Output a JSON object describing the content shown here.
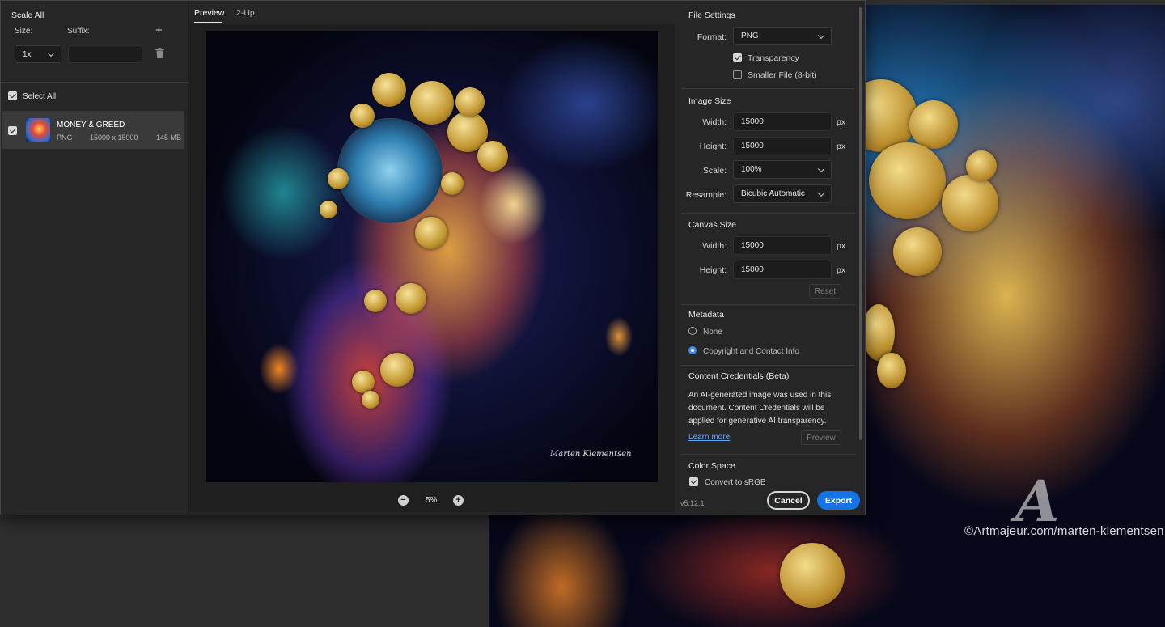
{
  "left_panel": {
    "scale_all_title": "Scale All",
    "size_label": "Size:",
    "suffix_label": "Suffix:",
    "size_value": "1x",
    "suffix_value": "",
    "select_all_label": "Select All",
    "asset": {
      "name": "MONEY & GREED",
      "format": "PNG",
      "dimensions": "15000 x 15000",
      "file_size": "145 MB"
    }
  },
  "preview": {
    "tabs": [
      "Preview",
      "2-Up"
    ],
    "zoom_level": "5%",
    "signature": "Marten Klementsen"
  },
  "file_settings": {
    "title": "File Settings",
    "format_label": "Format:",
    "format_value": "PNG",
    "transparency_label": "Transparency",
    "transparency_checked": true,
    "smaller_file_label": "Smaller File (8-bit)",
    "smaller_file_checked": false
  },
  "image_size": {
    "title": "Image Size",
    "width_label": "Width:",
    "width_value": "15000",
    "height_label": "Height:",
    "height_value": "15000",
    "unit": "px",
    "scale_label": "Scale:",
    "scale_value": "100%",
    "resample_label": "Resample:",
    "resample_value": "Bicubic Automatic"
  },
  "canvas_size": {
    "title": "Canvas Size",
    "width_label": "Width:",
    "width_value": "15000",
    "height_label": "Height:",
    "height_value": "15000",
    "unit": "px",
    "reset_label": "Reset"
  },
  "metadata": {
    "title": "Metadata",
    "options": [
      "None",
      "Copyright and Contact Info"
    ],
    "selected": "Copyright and Contact Info"
  },
  "content_credentials": {
    "title": "Content Credentials (Beta)",
    "description": "An AI-generated image was used in this document. Content Credentials will be applied for generative AI transparency.",
    "learn_more": "Learn more",
    "preview_label": "Preview"
  },
  "color_space": {
    "title": "Color Space",
    "convert_label": "Convert to sRGB",
    "convert_checked": true
  },
  "footer": {
    "version": "v5.12.1",
    "cancel_label": "Cancel",
    "export_label": "Export"
  },
  "background": {
    "watermark": "©Artmajeur.com/marten-klementsen",
    "logo": "A"
  },
  "colors": {
    "accent": "#1473e6",
    "panel": "#262626",
    "selected_row": "#3a3a3a"
  }
}
